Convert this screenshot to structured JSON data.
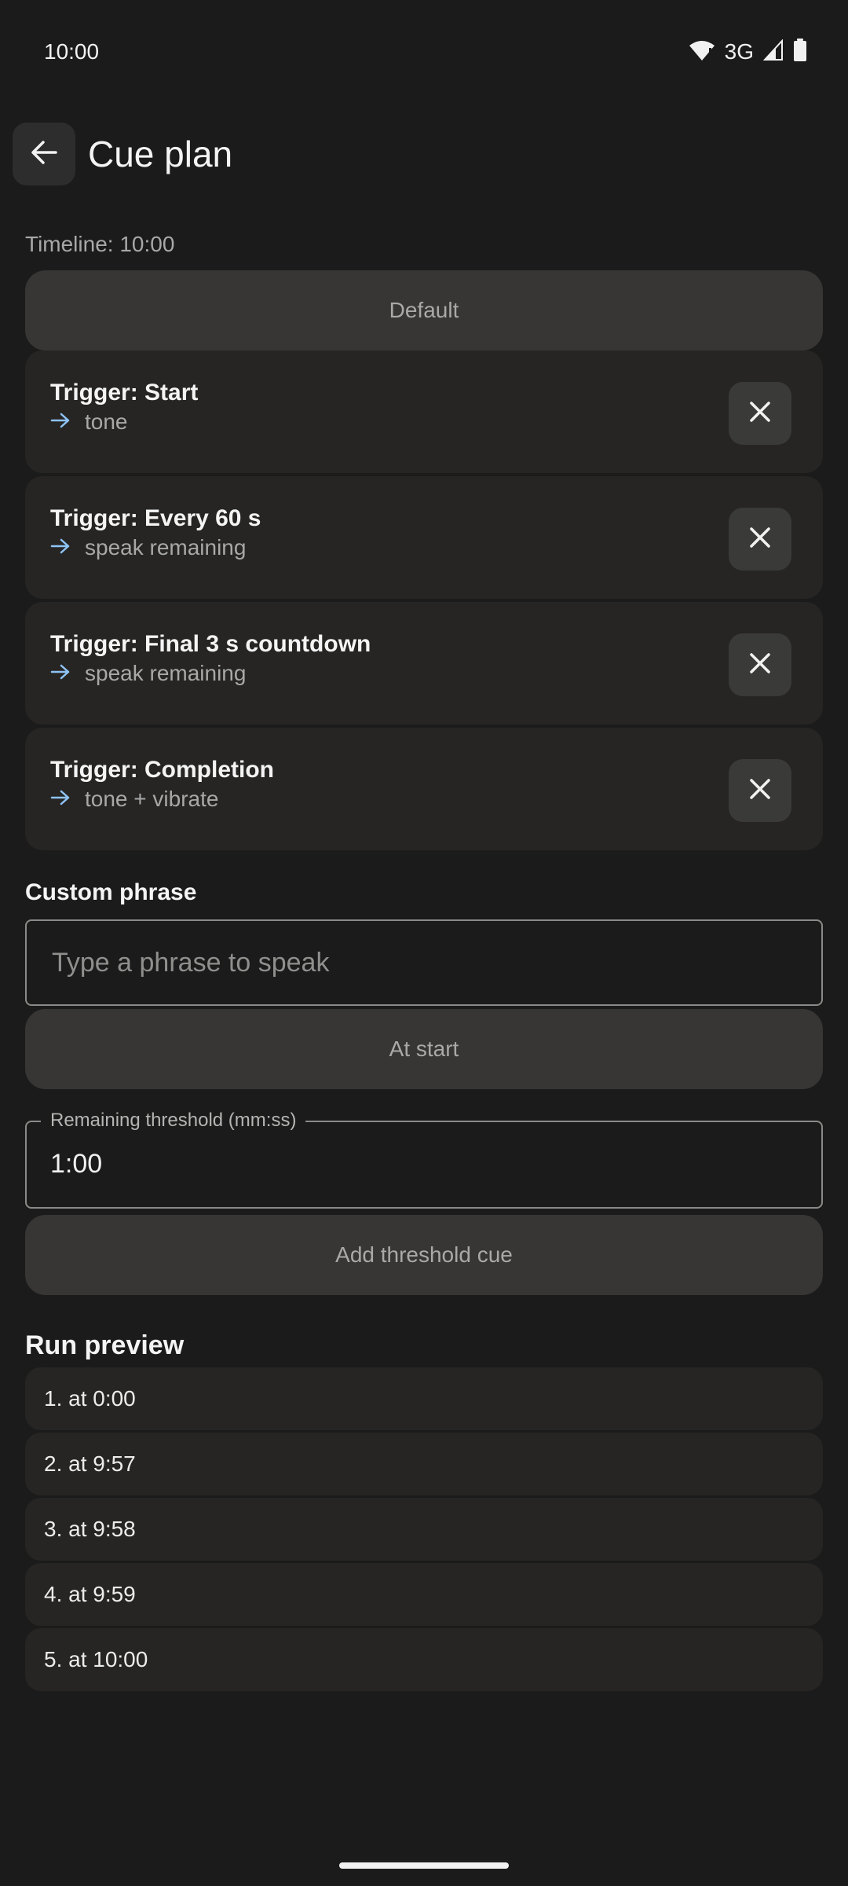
{
  "status_bar": {
    "time": "10:00",
    "network": "3G",
    "icons": [
      "wifi-alert-icon",
      "cell-signal-icon",
      "battery-icon"
    ]
  },
  "header": {
    "back_icon": "arrow-left-icon",
    "title": "Cue plan"
  },
  "timeline_label": "Timeline: 10:00",
  "default_button": "Default",
  "triggers": [
    {
      "title": "Trigger: Start",
      "action": "tone"
    },
    {
      "title": "Trigger: Every 60 s",
      "action": "speak remaining"
    },
    {
      "title": "Trigger: Final 3 s countdown",
      "action": "speak remaining"
    },
    {
      "title": "Trigger: Completion",
      "action": "tone + vibrate"
    }
  ],
  "custom_phrase": {
    "label": "Custom phrase",
    "placeholder": "Type a phrase to speak",
    "value": "",
    "at_start_button": "At start"
  },
  "threshold": {
    "label": "Remaining threshold (mm:ss)",
    "value": "1:00",
    "add_button": "Add threshold cue"
  },
  "run_preview": {
    "label": "Run preview",
    "items": [
      "1. at 0:00",
      "2. at 9:57",
      "3. at 9:58",
      "4. at 9:59",
      "5. at 10:00"
    ]
  },
  "colors": {
    "background": "#1b1b1b",
    "card": "#262523",
    "button": "#373634",
    "arrow_accent": "#8ec3f5"
  }
}
